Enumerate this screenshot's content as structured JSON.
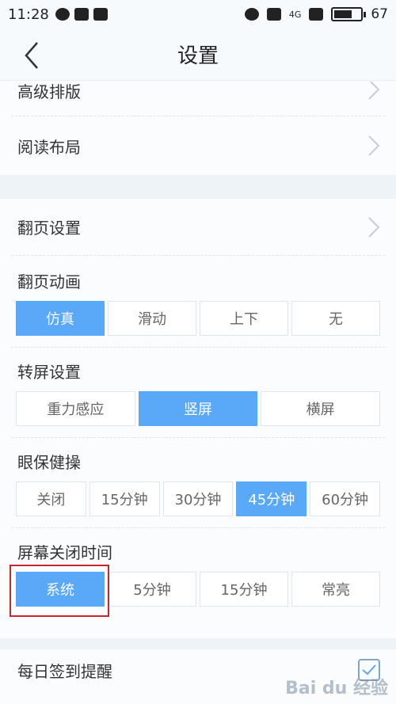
{
  "status_bar": {
    "time": "11:28",
    "network": "4G",
    "battery": "67",
    "battery_level": 0.67
  },
  "nav": {
    "title": "设置",
    "back_icon": "chevron-left-icon"
  },
  "rows_top": [
    {
      "label": "高级排版"
    },
    {
      "label": "阅读布局"
    }
  ],
  "page_turn": {
    "label": "翻页设置"
  },
  "animation": {
    "label": "翻页动画",
    "options": [
      "仿真",
      "滑动",
      "上下",
      "无"
    ],
    "selected": "仿真"
  },
  "rotation": {
    "label": "转屏设置",
    "options": [
      "重力感应",
      "竖屏",
      "横屏"
    ],
    "selected": "竖屏"
  },
  "eye_care": {
    "label": "眼保健操",
    "options": [
      "关闭",
      "15分钟",
      "30分钟",
      "45分钟",
      "60分钟"
    ],
    "selected": "45分钟"
  },
  "screen_off": {
    "label": "屏幕关闭时间",
    "options": [
      "系统",
      "5分钟",
      "15分钟",
      "常亮"
    ],
    "selected": "系统"
  },
  "daily_signin": {
    "label": "每日签到提醒",
    "checked": true
  },
  "watermark": "Bai du 经验",
  "colors": {
    "accent": "#5aa8f8",
    "highlight_border": "#c8282d"
  }
}
